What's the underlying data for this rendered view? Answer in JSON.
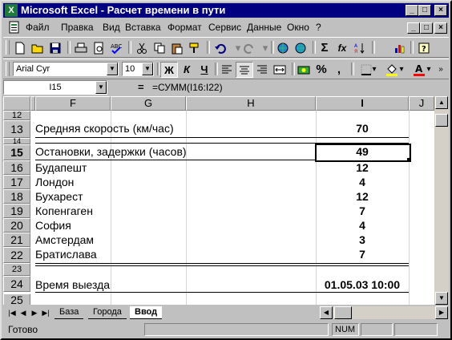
{
  "window": {
    "app_icon": "excel-icon",
    "title": "Microsoft Excel - Расчет времени в пути",
    "buttons": {
      "minimize": "_",
      "maximize": "□",
      "close": "×"
    }
  },
  "menu": {
    "items": [
      "Файл",
      "Правка",
      "Вид",
      "Вставка",
      "Формат",
      "Сервис",
      "Данные",
      "Окно",
      "?"
    ]
  },
  "toolbar_standard": {
    "icons": [
      "new-icon",
      "open-icon",
      "save-icon",
      "print-icon",
      "preview-icon",
      "spelling-icon",
      "cut-icon",
      "copy-icon",
      "paste-icon",
      "format-painter-icon",
      "undo-icon",
      "redo-icon",
      "hyperlink-icon",
      "web-icon",
      "autosum-icon",
      "function-icon",
      "sort-icon",
      "chart-wizard-icon",
      "help-icon"
    ],
    "autosum": "Σ",
    "function": "fx"
  },
  "toolbar_format": {
    "font": "Arial Cyr",
    "size": "10",
    "bold": "Ж",
    "italic": "К",
    "underline": "Ч",
    "percent": "%",
    "comma": ","
  },
  "formula_bar": {
    "name_box": "I15",
    "eq": "=",
    "formula": "=СУММ(I16:I22)"
  },
  "sheet": {
    "columns": [
      "F",
      "G",
      "H",
      "I",
      "J"
    ],
    "active_column": "I",
    "active_cell": "I15",
    "rows": [
      {
        "n": "12",
        "label": "",
        "value": ""
      },
      {
        "n": "13",
        "label": "Средняя скорость (км/час)",
        "value": "70"
      },
      {
        "n": "14",
        "label": "",
        "value": ""
      },
      {
        "n": "15",
        "label": "Остановки, задержки (часов)",
        "value": "49"
      },
      {
        "n": "16",
        "label": "Будапешт",
        "value": "12"
      },
      {
        "n": "17",
        "label": "Лондон",
        "value": "4"
      },
      {
        "n": "18",
        "label": "Бухарест",
        "value": "12"
      },
      {
        "n": "19",
        "label": "Копенгаген",
        "value": "7"
      },
      {
        "n": "20",
        "label": "София",
        "value": "4"
      },
      {
        "n": "21",
        "label": "Амстердам",
        "value": "3"
      },
      {
        "n": "22",
        "label": "Братислава",
        "value": "7"
      },
      {
        "n": "23",
        "label": "",
        "value": ""
      },
      {
        "n": "24",
        "label": "Время выезда",
        "value": "01.05.03 10:00"
      },
      {
        "n": "25",
        "label": "",
        "value": ""
      }
    ]
  },
  "tabs": {
    "items": [
      "База",
      "Города",
      "Ввод"
    ],
    "active": "Ввод"
  },
  "status": {
    "text": "Готово",
    "num": "NUM"
  }
}
